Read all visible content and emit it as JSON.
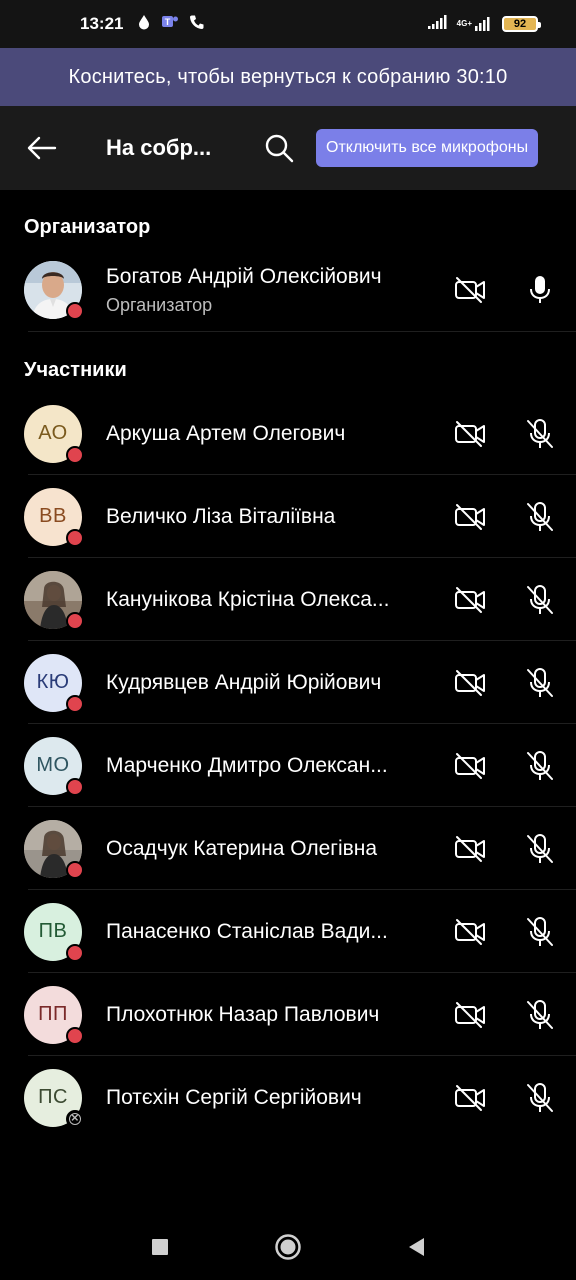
{
  "status_bar": {
    "time": "13:21",
    "battery": "92",
    "network_label": "4G+"
  },
  "banner": {
    "text": "Коснитесь, чтобы вернуться к собранию 30:10"
  },
  "toolbar": {
    "title": "На собр...",
    "mute_all_label": "Отключить все микрофоны"
  },
  "sections": {
    "organizer_header": "Организатор",
    "participants_header": "Участники"
  },
  "organizer": {
    "name": "Богатов Андрій Олексійович",
    "role": "Организатор",
    "mic": "on",
    "camera": "off"
  },
  "participants": [
    {
      "initials": "АО",
      "name": "Аркуша Артем Олегович",
      "avatar_bg": "#f4e6c8",
      "avatar_fg": "#7a5a1e",
      "status": "busy"
    },
    {
      "initials": "ВВ",
      "name": "Величко Ліза Віталіївна",
      "avatar_bg": "#f7e3cf",
      "avatar_fg": "#8a4b20",
      "status": "busy"
    },
    {
      "initials": "",
      "name": "Канунікова Крістіна Олекса...",
      "avatar_bg": "#8a7a6a",
      "avatar_fg": "#ffffff",
      "status": "busy",
      "photo": true
    },
    {
      "initials": "КЮ",
      "name": "Кудрявцев Андрій Юрійович",
      "avatar_bg": "#dfe6f7",
      "avatar_fg": "#2a3c78",
      "status": "busy"
    },
    {
      "initials": "МО",
      "name": "Марченко Дмитро Олексан...",
      "avatar_bg": "#dde9ee",
      "avatar_fg": "#2f5560",
      "status": "busy"
    },
    {
      "initials": "",
      "name": "Осадчук Катерина Олегівна",
      "avatar_bg": "#9a948c",
      "avatar_fg": "#ffffff",
      "status": "busy",
      "photo": true
    },
    {
      "initials": "ПВ",
      "name": "Панасенко Станіслав Вади...",
      "avatar_bg": "#d8f0df",
      "avatar_fg": "#235a35",
      "status": "busy"
    },
    {
      "initials": "ПП",
      "name": "Плохотнюк Назар Павлович",
      "avatar_bg": "#f3dcdc",
      "avatar_fg": "#7a2a2a",
      "status": "busy"
    },
    {
      "initials": "ПС",
      "name": "Потєхін Сергій Сергійович",
      "avatar_bg": "#e6eedf",
      "avatar_fg": "#3c4a32",
      "status": "offline"
    }
  ],
  "icons": {
    "camera_off": "video-off-icon",
    "mic_on": "mic-icon",
    "mic_off": "mic-off-icon"
  },
  "colors": {
    "banner": "#4b4a7a",
    "accent_button": "#7b7fe8",
    "presence_busy": "#e0444e"
  }
}
